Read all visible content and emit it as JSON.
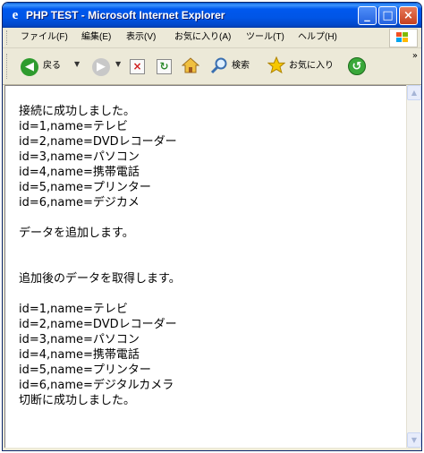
{
  "window": {
    "title": "PHP TEST - Microsoft Internet Explorer",
    "app_icon": "ie-document-icon",
    "controls": [
      "minimize",
      "maximize",
      "close"
    ]
  },
  "menubar": {
    "items": [
      "ファイル(F)",
      "編集(E)",
      "表示(V)",
      "お気に入り(A)",
      "ツール(T)",
      "ヘルプ(H)"
    ]
  },
  "toolbar": {
    "back_label": "戻る",
    "search_label": "検索",
    "favorites_label": "お気に入り",
    "icons": [
      "back-arrow-icon",
      "forward-arrow-icon",
      "stop-icon",
      "refresh-icon",
      "home-icon",
      "search-icon",
      "favorites-star-icon",
      "history-icon"
    ]
  },
  "content": {
    "connect_message": "接続に成功しました。",
    "initial_rows": [
      "id=1,name=テレビ",
      "id=2,name=DVDレコーダー",
      "id=3,name=パソコン",
      "id=4,name=携帯電話",
      "id=5,name=プリンター",
      "id=6,name=デジカメ"
    ],
    "add_message": "データを追加します。",
    "fetch_message": "追加後のデータを取得します。",
    "updated_rows": [
      "id=1,name=テレビ",
      "id=2,name=DVDレコーダー",
      "id=3,name=パソコン",
      "id=4,name=携帯電話",
      "id=5,name=プリンター",
      "id=6,name=デジタルカメラ"
    ],
    "disconnect_message": "切断に成功しました。"
  },
  "colors": {
    "titlebar": "#0055e6",
    "chrome": "#ece9d8",
    "page_background": "#ffffff"
  }
}
